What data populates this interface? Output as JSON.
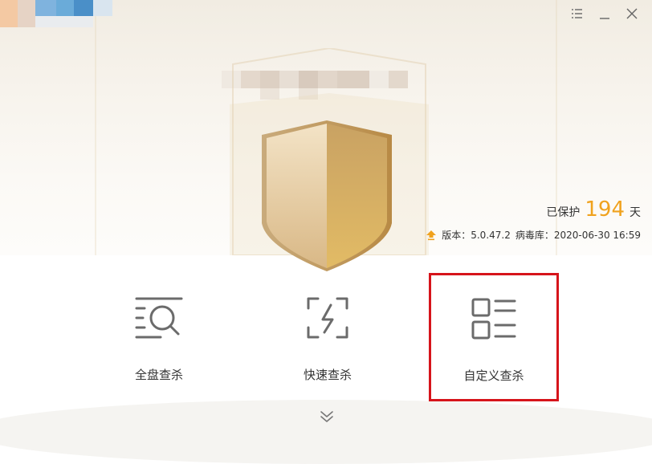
{
  "window": {
    "controls": [
      "menu-icon",
      "minimize-icon",
      "close-icon"
    ]
  },
  "status": {
    "protected_prefix": "已保护",
    "protected_days": "194",
    "protected_suffix": "天",
    "version_label": "版本：5.0.47.2",
    "virus_db_label": "病毒库：2020-06-30 16:59"
  },
  "scan_options": [
    {
      "label": "全盘查杀",
      "icon": "full-scan-icon"
    },
    {
      "label": "快速查杀",
      "icon": "quick-scan-icon"
    },
    {
      "label": "自定义查杀",
      "icon": "custom-scan-icon",
      "selected": true
    }
  ],
  "colors": {
    "accent_gold": "#f0a21e",
    "selection_red": "#d6141b",
    "icon_gray": "#6b6b6b",
    "shield_gold": "#c9a263"
  },
  "footer": {
    "icon": "chevron-double-down-icon"
  }
}
